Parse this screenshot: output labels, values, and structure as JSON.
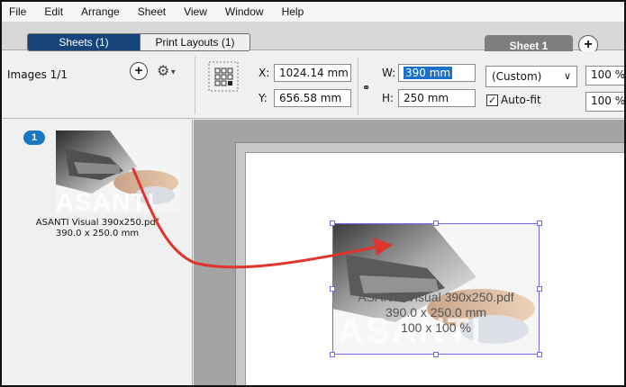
{
  "menu": [
    "File",
    "Edit",
    "Arrange",
    "Sheet",
    "View",
    "Window",
    "Help"
  ],
  "tabs": {
    "sheets_label": "Sheets (1)",
    "print_layouts_label": "Print Layouts (1)",
    "sheet_tab_label": "Sheet 1",
    "add_sheet_icon": "+"
  },
  "toolbar": {
    "images_label": "Images 1/1",
    "add_icon": "+",
    "x_label": "X:",
    "x_value": "1024.14 mm",
    "y_label": "Y:",
    "y_value": "656.58 mm",
    "w_label": "W:",
    "w_value": "390 mm",
    "h_label": "H:",
    "h_value": "250 mm",
    "size_preset": "(Custom)",
    "autofit_label": "Auto-fit",
    "autofit_checked": true,
    "scale_top": "100 %",
    "scale_bottom": "100 %"
  },
  "left_panel": {
    "badge": "1",
    "thumb_watermark": "ASANTI",
    "caption_line1": "ASANTI Visual 390x250.pdf",
    "caption_line2": "390.0 x 250.0 mm"
  },
  "canvas": {
    "watermark": "ASANTI",
    "overlay_name": "ASANTI Visual 390x250.pdf",
    "overlay_size": "390.0 x 250.0 mm",
    "overlay_scale": "100 x 100 %"
  },
  "colors": {
    "accent_tab": "#16447a",
    "selection_frame": "#6e6ce0",
    "badge": "#1a78c2",
    "arrow": "#e0342e"
  }
}
